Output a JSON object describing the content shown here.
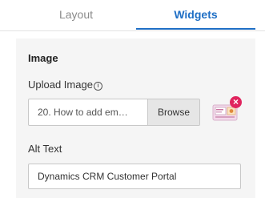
{
  "tabs": [
    {
      "label": "Layout",
      "active": false
    },
    {
      "label": "Widgets",
      "active": true
    }
  ],
  "colors": {
    "accent": "#1f6fc5",
    "remove": "#e0245e",
    "panel_bg": "#f5f5f5"
  },
  "image_section": {
    "title": "Image",
    "upload_label": "Upload Image",
    "info_icon": "info-circle-icon",
    "file_name": "20. How to add em…",
    "browse_label": "Browse",
    "thumbnail_icon": "image-thumbnail-icon",
    "remove_icon": "close-icon",
    "alt_label": "Alt Text",
    "alt_value": "Dynamics CRM Customer Portal"
  }
}
